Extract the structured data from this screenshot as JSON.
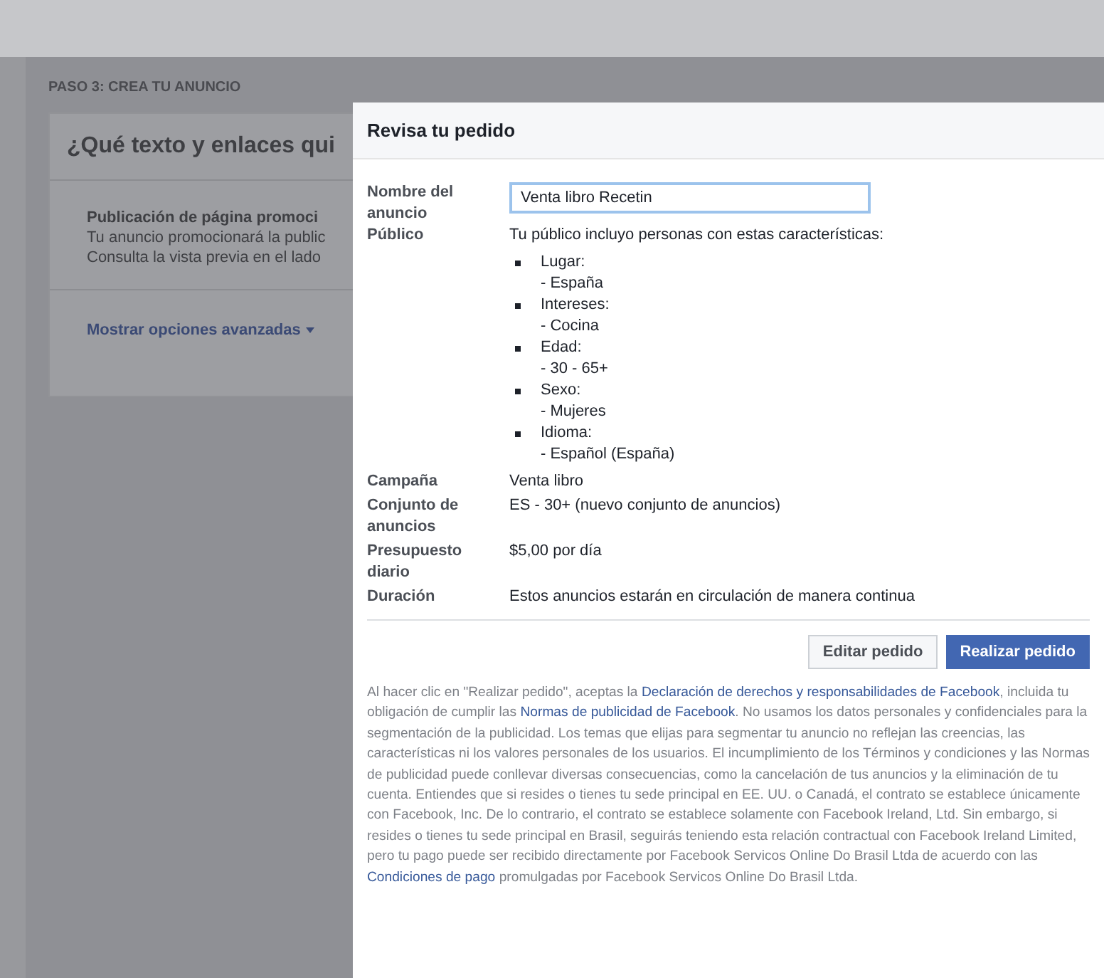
{
  "page": {
    "step_label": "PASO 3: CREA TU ANUNCIO",
    "card_title": "¿Qué texto y enlaces qui",
    "section_title": "Publicación de página promoci",
    "section_lines": [
      "Tu anuncio promocionará la public",
      "Consulta la vista previa en el lado"
    ],
    "advanced_link": "Mostrar opciones avanzadas"
  },
  "dialog": {
    "title": "Revisa tu pedido",
    "name_field": {
      "label": "Nombre del anuncio",
      "value": "Venta libro Recetin"
    },
    "audience": {
      "label": "Público",
      "intro": "Tu público incluyo personas con estas características:",
      "items": [
        {
          "title": "Lugar:",
          "value": "- España"
        },
        {
          "title": "Intereses:",
          "value": "- Cocina"
        },
        {
          "title": "Edad:",
          "value": "- 30 - 65+"
        },
        {
          "title": "Sexo:",
          "value": "- Mujeres"
        },
        {
          "title": "Idioma:",
          "value": "- Español (España)"
        }
      ]
    },
    "rows": [
      {
        "label": "Campaña",
        "value": "Venta libro"
      },
      {
        "label": "Conjunto de anuncios",
        "value": "ES - 30+ (nuevo conjunto de anuncios)"
      },
      {
        "label": "Presupuesto diario",
        "value": "$5,00 por día"
      },
      {
        "label": "Duración",
        "value": "Estos anuncios estarán en circulación de manera continua"
      }
    ],
    "buttons": [
      {
        "label": "Editar pedido",
        "kind": "secondary"
      },
      {
        "label": "Realizar pedido",
        "kind": "primary"
      }
    ],
    "legal": [
      {
        "text": "Al hacer clic en \"Realizar pedido\", aceptas la ",
        "kind": "text"
      },
      {
        "text": "Declaración de derechos y responsabilidades de Facebook",
        "kind": "link"
      },
      {
        "text": ", incluida tu obligación de cumplir las ",
        "kind": "text"
      },
      {
        "text": "Normas de publicidad de Facebook",
        "kind": "link"
      },
      {
        "text": ". No usamos los datos personales y confidenciales para la segmentación de la publicidad. Los temas que elijas para segmentar tu anuncio no reflejan las creencias, las características ni los valores personales de los usuarios. El incumplimiento de los Términos y condiciones y las Normas de publicidad puede conllevar diversas consecuencias, como la cancelación de tus anuncios y la eliminación de tu cuenta. Entiendes que si resides o tienes tu sede principal en EE. UU. o Canadá, el contrato se establece únicamente con Facebook, Inc. De lo contrario, el contrato se establece solamente con Facebook Ireland, Ltd. Sin embargo, si resides o tienes tu sede principal en Brasil, seguirás teniendo esta relación contractual con Facebook Ireland Limited, pero tu pago puede ser recibido directamente por Facebook Servicos Online Do Brasil Ltda de acuerdo con las ",
        "kind": "text"
      },
      {
        "text": "Condiciones de pago",
        "kind": "link"
      },
      {
        "text": " promulgadas por Facebook Servicos Online Do Brasil Ltda.",
        "kind": "text"
      }
    ]
  }
}
